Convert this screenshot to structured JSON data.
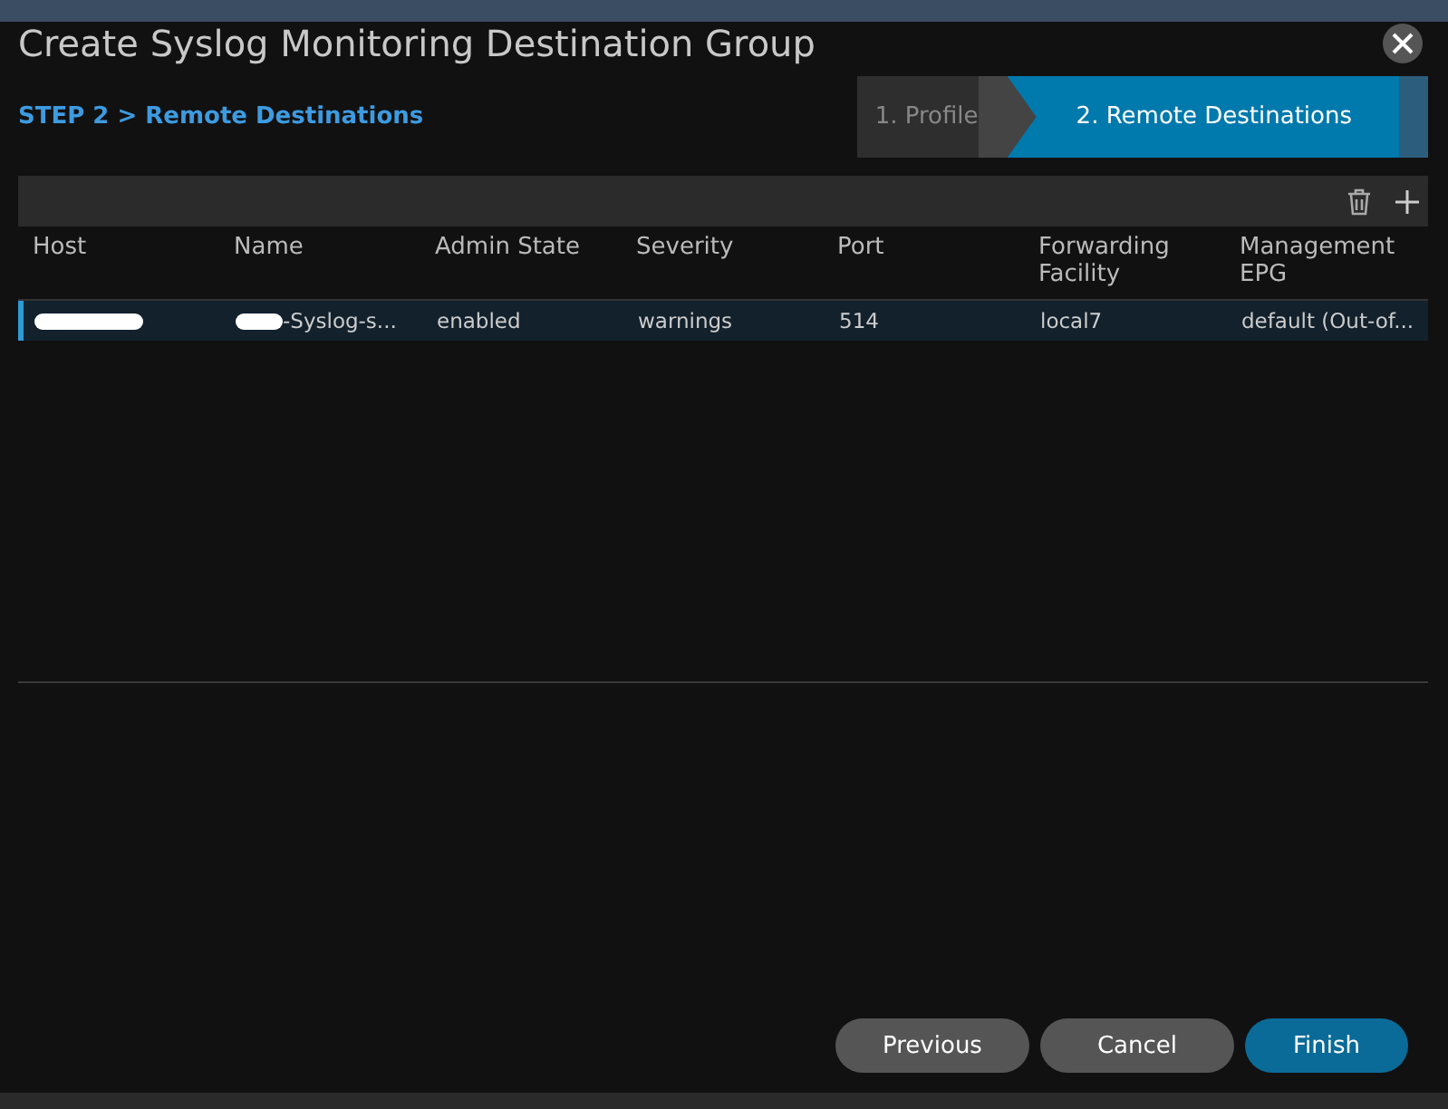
{
  "window": {
    "title": "Create Syslog Monitoring Destination Group"
  },
  "step_heading": "STEP 2 > Remote Destinations",
  "wizard_steps": [
    {
      "label": "1. Profile",
      "selected": false
    },
    {
      "label": "2. Remote Destinations",
      "selected": true
    }
  ],
  "table": {
    "columns": [
      "Host",
      "Name",
      "Admin State",
      "Severity",
      "Port",
      "Forwarding Facility",
      "Management EPG"
    ],
    "rows": [
      {
        "selected": true,
        "cells": [
          {
            "text": "",
            "redacted": true
          },
          {
            "text": "-Syslog-s...",
            "redacted": true
          },
          {
            "text": "enabled",
            "redacted": false
          },
          {
            "text": "warnings",
            "redacted": false
          },
          {
            "text": "514",
            "redacted": false
          },
          {
            "text": "local7",
            "redacted": false
          },
          {
            "text": "default (Out-of...",
            "redacted": false
          }
        ]
      }
    ]
  },
  "buttons": [
    {
      "label": "Previous",
      "kind": "secondary"
    },
    {
      "label": "Cancel",
      "kind": "secondary"
    },
    {
      "label": "Finish",
      "kind": "primary"
    }
  ]
}
